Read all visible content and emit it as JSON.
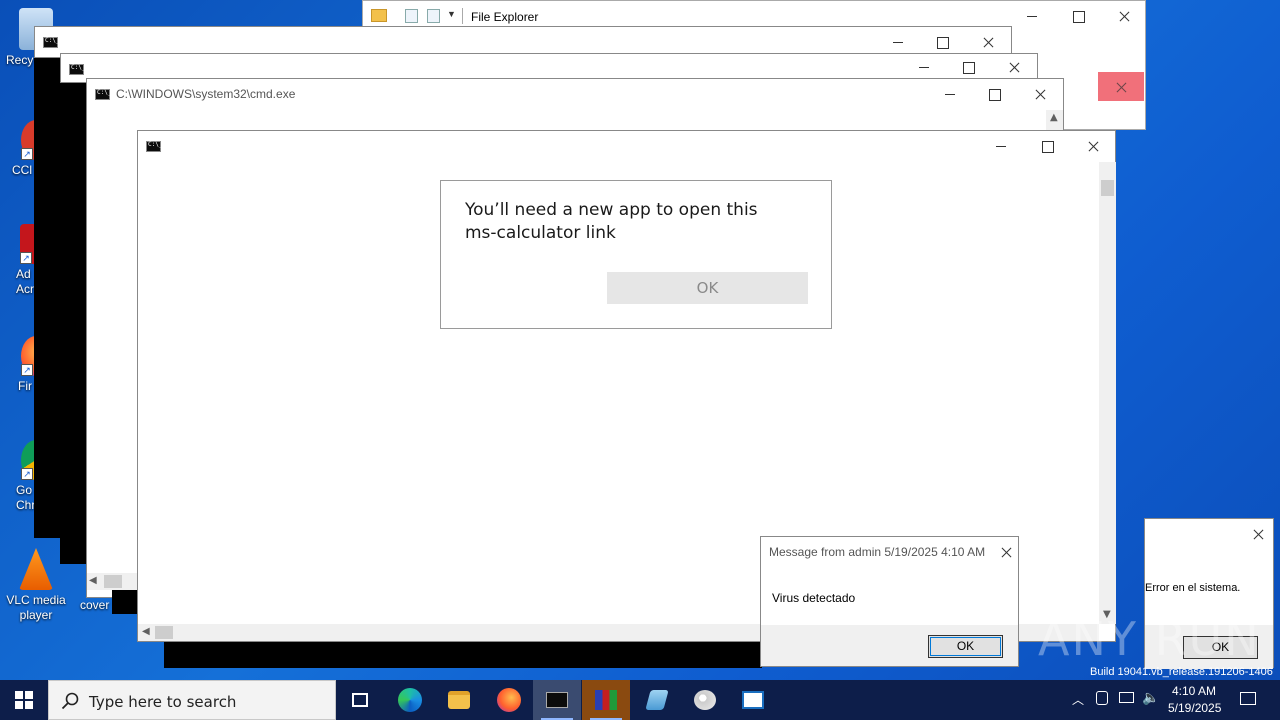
{
  "desktop": {
    "icons": [
      {
        "label": "Recy"
      },
      {
        "label": "CCl"
      },
      {
        "label": "Ad\nAcr"
      },
      {
        "label": "Fir"
      },
      {
        "label": "Go\nChr"
      },
      {
        "label": "VLC media player"
      },
      {
        "label": "cover"
      }
    ],
    "watermark": "ANY RUN",
    "build_text": "Build 19041.vb_release.191206-1406"
  },
  "explorer_window": {
    "title": "File Explorer"
  },
  "cmd_window": {
    "title": "C:\\WINDOWS\\system32\\cmd.exe"
  },
  "app_dialog": {
    "message": "You’ll need a new app to open this ms-calculator link",
    "ok_label": "OK"
  },
  "message_box": {
    "title": "Message from admin 5/19/2025 4:10 AM",
    "text": "Virus detectado",
    "ok_label": "OK"
  },
  "error_box": {
    "text": "Error en el sistema.",
    "ok_label": "OK"
  },
  "taskbar": {
    "search_placeholder": "Type here to search",
    "time": "4:10 AM",
    "date": "5/19/2025",
    "apps": [
      "task-view",
      "edge",
      "file-explorer",
      "firefox",
      "cmd",
      "winrar",
      "notepad",
      "paint",
      "wordpad"
    ]
  },
  "colors": {
    "desktop_blue": "#1570d8",
    "taskbar": "#0d1e4a",
    "close_hover": "#e81123"
  }
}
